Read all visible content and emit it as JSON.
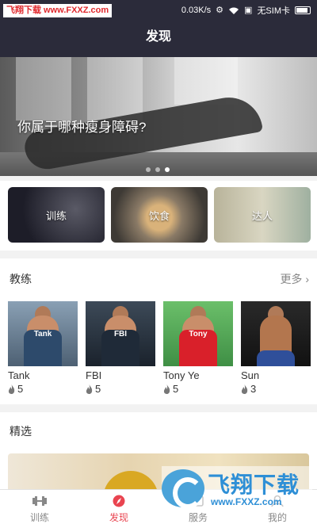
{
  "statusbar": {
    "watermark_text": "飞翔下载 www.FXXZ.com",
    "speed": "0.03K/s",
    "carrier": "无SIM卡",
    "icons": [
      "settings-icon",
      "wifi-icon",
      "sim-icon",
      "battery-icon"
    ]
  },
  "header": {
    "title": "发现"
  },
  "banner": {
    "title": "你属于哪种瘦身障碍?",
    "page_count": 3,
    "active_page": 3
  },
  "categories": [
    {
      "label": "训练"
    },
    {
      "label": "饮食"
    },
    {
      "label": "达人"
    }
  ],
  "coaches": {
    "title": "教练",
    "more_label": "更多",
    "items": [
      {
        "name": "Tank",
        "likes": "5",
        "shirt_text": "Tank",
        "shirt_color": "#2d4a6b"
      },
      {
        "name": "FBI",
        "likes": "5",
        "shirt_text": "FBI",
        "shirt_color": "#1f2a38"
      },
      {
        "name": "Tony Ye",
        "likes": "5",
        "shirt_text": "Tony",
        "shirt_color": "#d9202a"
      },
      {
        "name": "Sun",
        "likes": "3",
        "shirt_text": "",
        "shirt_color": "#3a3a3a"
      }
    ]
  },
  "featured": {
    "title": "精选"
  },
  "tabbar": {
    "items": [
      {
        "label": "训练",
        "icon": "dumbbell-icon",
        "active": false
      },
      {
        "label": "发现",
        "icon": "compass-icon",
        "active": true
      },
      {
        "label": "服务",
        "icon": "service-icon",
        "active": false
      },
      {
        "label": "我的",
        "icon": "profile-icon",
        "active": false
      }
    ]
  },
  "watermark": {
    "brand": "飞翔下载",
    "url": "www.FXXZ.com"
  },
  "colors": {
    "bar_bg": "#2b2b3a",
    "accent": "#e94450"
  }
}
